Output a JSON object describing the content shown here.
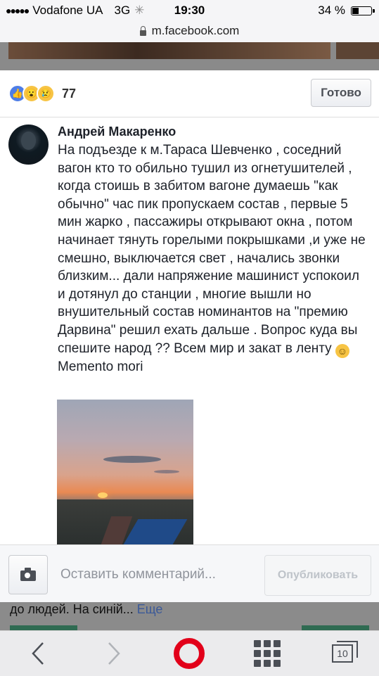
{
  "status_bar": {
    "carrier": "Vodafone UA",
    "network": "3G",
    "time": "19:30",
    "battery": "34 %"
  },
  "url_bar": {
    "url": "m.facebook.com"
  },
  "reactions": {
    "count": "77",
    "types": [
      "like",
      "wow",
      "sad"
    ]
  },
  "header": {
    "done_label": "Готово"
  },
  "comment": {
    "author": "Андрей Макаренко",
    "text": "На подъезде к м.Тараса Шевченко , соседний вагон кто то обильно тушил из огнетушителей , когда стоишь в забитом вагоне думаешь \"как обычно\" час пик пропускаем состав , первые 5 мин жарко , пассажиры открывают окна , потом начинает тянуть горелыми покрышками ,и уже не смешно, выключается свет , начались звонки близким... дали напряжение машинист успокоил и дотянул до станции , многие вышли но внушительный состав номинантов на \"премию Дарвина\" решил ехать дальше . Вопрос куда вы спешите народ ?? Всем мир и закат в ленту",
    "text_suffix": "Memento mori"
  },
  "footer": {
    "comment_placeholder": "Оставить комментарий...",
    "publish_label": "Опубликовать"
  },
  "background_post": {
    "snippet": "до людей. На синій...",
    "more_link": "Еще"
  },
  "toolbar": {
    "tab_count": "10"
  },
  "colors": {
    "accent": "#3b5998",
    "opera_red": "#e2001a"
  }
}
